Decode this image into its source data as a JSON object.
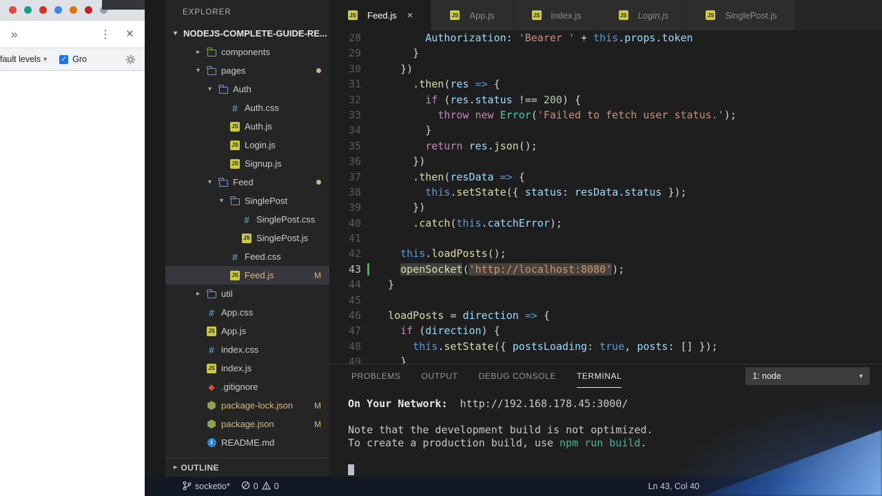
{
  "colors": {
    "git_modified": "#d7ba7d",
    "js_icon": "#cbcb41",
    "css_icon": "#519aba",
    "git_icon": "#e1503c",
    "npm_icon": "#8aa34f",
    "readme_icon": "#2f86d2",
    "modified_gutter": "#3fb950",
    "terminal_command": "#45b797",
    "glare_blue": "#3c82ff"
  },
  "browser": {
    "favicons": [
      {
        "name": "favicon-1",
        "color": "#e8453c"
      },
      {
        "name": "favicon-2",
        "color": "#1f9d8b"
      },
      {
        "name": "favicon-3",
        "color": "#d93025"
      },
      {
        "name": "favicon-4",
        "color": "#4285f4"
      },
      {
        "name": "favicon-5",
        "color": "#e37400"
      },
      {
        "name": "favicon-6",
        "color": "#c5221f"
      },
      {
        "name": "favicon-7",
        "color": "#9aa0a6"
      }
    ],
    "toolbar": {
      "overflow": "»",
      "menu": "⋮",
      "close": "×"
    },
    "console_bar": {
      "levels_label": "fault levels",
      "caret": "▾",
      "check": "✓",
      "group_label": "Gro"
    }
  },
  "sidebar": {
    "title": "EXPLORER",
    "section": {
      "chevron": "▾",
      "label": "NODEJS-COMPLETE-GUIDE-RE..."
    },
    "items": [
      {
        "label": "components",
        "icon": "folder",
        "icon_color": "#7cb342",
        "depth": 1,
        "chevron": "closed"
      },
      {
        "label": "pages",
        "icon": "folder",
        "depth": 1,
        "chevron": "open",
        "dot": true
      },
      {
        "label": "Auth",
        "icon": "folder",
        "depth": 2,
        "chevron": "open"
      },
      {
        "label": "Auth.css",
        "icon": "css",
        "depth": 3
      },
      {
        "label": "Auth.js",
        "icon": "js",
        "depth": 3
      },
      {
        "label": "Login.js",
        "icon": "js",
        "depth": 3
      },
      {
        "label": "Signup.js",
        "icon": "js",
        "depth": 3
      },
      {
        "label": "Feed",
        "icon": "folder",
        "depth": 2,
        "chevron": "open",
        "dot": true
      },
      {
        "label": "SinglePost",
        "icon": "folder",
        "depth": 3,
        "chevron": "open"
      },
      {
        "label": "SinglePost.css",
        "icon": "css",
        "depth": 4
      },
      {
        "label": "SinglePost.js",
        "icon": "js",
        "depth": 4
      },
      {
        "label": "Feed.css",
        "icon": "css",
        "depth": 3
      },
      {
        "label": "Feed.js",
        "icon": "js",
        "depth": 3,
        "selected": true,
        "badge": "M",
        "modified": true
      },
      {
        "label": "util",
        "icon": "folder",
        "depth": 1,
        "chevron": "closed"
      },
      {
        "label": "App.css",
        "icon": "css",
        "depth": 1
      },
      {
        "label": "App.js",
        "icon": "js",
        "depth": 1
      },
      {
        "label": "index.css",
        "icon": "css",
        "depth": 1
      },
      {
        "label": "index.js",
        "icon": "js",
        "depth": 1
      },
      {
        "label": ".gitignore",
        "icon": "git",
        "depth": 1
      },
      {
        "label": "package-lock.json",
        "icon": "npm",
        "depth": 1,
        "badge": "M",
        "modified": true
      },
      {
        "label": "package.json",
        "icon": "npm",
        "depth": 1,
        "badge": "M",
        "modified": true
      },
      {
        "label": "README.md",
        "icon": "info",
        "depth": 1
      }
    ],
    "outline": {
      "chevron": "▸",
      "label": "OUTLINE"
    }
  },
  "tabs": [
    {
      "label": "Feed.js",
      "icon": "js",
      "active": true,
      "close": "×"
    },
    {
      "label": "App.js",
      "icon": "js"
    },
    {
      "label": "index.js",
      "icon": "js"
    },
    {
      "label": "Login.js",
      "icon": "js",
      "italic": true
    },
    {
      "label": "SinglePost.js",
      "icon": "js"
    }
  ],
  "editor": {
    "lines": [
      {
        "num": "28",
        "tokens": [
          [
            "pl",
            "        "
          ],
          [
            "pr",
            "Authorization"
          ],
          [
            "pl",
            ": "
          ],
          [
            "st",
            "'Bearer '"
          ],
          [
            "pl",
            " + "
          ],
          [
            "kb",
            "this"
          ],
          [
            "pl",
            "."
          ],
          [
            "pr",
            "props"
          ],
          [
            "pl",
            "."
          ],
          [
            "pr",
            "token"
          ]
        ]
      },
      {
        "num": "29",
        "tokens": [
          [
            "pl",
            "      }"
          ]
        ]
      },
      {
        "num": "30",
        "tokens": [
          [
            "pl",
            "    })"
          ]
        ]
      },
      {
        "num": "31",
        "tokens": [
          [
            "pl",
            "      ."
          ],
          [
            "fn",
            "then"
          ],
          [
            "pl",
            "("
          ],
          [
            "pr",
            "res"
          ],
          [
            "pl",
            " "
          ],
          [
            "kb",
            "=>"
          ],
          [
            "pl",
            " {"
          ]
        ]
      },
      {
        "num": "32",
        "tokens": [
          [
            "pl",
            "        "
          ],
          [
            "kw",
            "if"
          ],
          [
            "pl",
            " ("
          ],
          [
            "pr",
            "res"
          ],
          [
            "pl",
            "."
          ],
          [
            "pr",
            "status"
          ],
          [
            "pl",
            " !== "
          ],
          [
            "nu",
            "200"
          ],
          [
            "pl",
            ") {"
          ]
        ]
      },
      {
        "num": "33",
        "tokens": [
          [
            "pl",
            "          "
          ],
          [
            "kw",
            "throw"
          ],
          [
            "pl",
            " "
          ],
          [
            "kw",
            "new"
          ],
          [
            "pl",
            " "
          ],
          [
            "cl2",
            "Error"
          ],
          [
            "pl",
            "("
          ],
          [
            "st",
            "'Failed to fetch user status.'"
          ],
          [
            "pl",
            ");"
          ]
        ]
      },
      {
        "num": "34",
        "tokens": [
          [
            "pl",
            "        }"
          ]
        ]
      },
      {
        "num": "35",
        "tokens": [
          [
            "pl",
            "        "
          ],
          [
            "kw",
            "return"
          ],
          [
            "pl",
            " "
          ],
          [
            "pr",
            "res"
          ],
          [
            "pl",
            "."
          ],
          [
            "fn",
            "json"
          ],
          [
            "pl",
            "();"
          ]
        ]
      },
      {
        "num": "36",
        "tokens": [
          [
            "pl",
            "      })"
          ]
        ]
      },
      {
        "num": "37",
        "tokens": [
          [
            "pl",
            "      ."
          ],
          [
            "fn",
            "then"
          ],
          [
            "pl",
            "("
          ],
          [
            "pr",
            "resData"
          ],
          [
            "pl",
            " "
          ],
          [
            "kb",
            "=>"
          ],
          [
            "pl",
            " {"
          ]
        ]
      },
      {
        "num": "38",
        "tokens": [
          [
            "pl",
            "        "
          ],
          [
            "kb",
            "this"
          ],
          [
            "pl",
            "."
          ],
          [
            "fn",
            "setState"
          ],
          [
            "pl",
            "({ "
          ],
          [
            "pr",
            "status"
          ],
          [
            "pl",
            ": "
          ],
          [
            "pr",
            "resData"
          ],
          [
            "pl",
            "."
          ],
          [
            "pr",
            "status"
          ],
          [
            "pl",
            " });"
          ]
        ]
      },
      {
        "num": "39",
        "tokens": [
          [
            "pl",
            "      })"
          ]
        ]
      },
      {
        "num": "40",
        "tokens": [
          [
            "pl",
            "      ."
          ],
          [
            "fn",
            "catch"
          ],
          [
            "pl",
            "("
          ],
          [
            "kb",
            "this"
          ],
          [
            "pl",
            "."
          ],
          [
            "pr",
            "catchError"
          ],
          [
            "pl",
            ");"
          ]
        ]
      },
      {
        "num": "41",
        "tokens": []
      },
      {
        "num": "42",
        "tokens": [
          [
            "pl",
            "    "
          ],
          [
            "kb",
            "this"
          ],
          [
            "pl",
            "."
          ],
          [
            "fn",
            "loadPosts"
          ],
          [
            "pl",
            "();"
          ]
        ]
      },
      {
        "num": "43",
        "current": true,
        "modified": true,
        "tokens": [
          [
            "pl",
            "    "
          ],
          [
            "fn hlw",
            "openSocket"
          ],
          [
            "pl",
            "("
          ],
          [
            "st hls",
            "'http://localhost:8080'"
          ],
          [
            "pl",
            ");"
          ]
        ]
      },
      {
        "num": "44",
        "tokens": [
          [
            "pl",
            "  }"
          ]
        ]
      },
      {
        "num": "45",
        "tokens": []
      },
      {
        "num": "46",
        "tokens": [
          [
            "pl",
            "  "
          ],
          [
            "fn",
            "loadPosts"
          ],
          [
            "pl",
            " = "
          ],
          [
            "pr",
            "direction"
          ],
          [
            "pl",
            " "
          ],
          [
            "kb",
            "=>"
          ],
          [
            "pl",
            " {"
          ]
        ]
      },
      {
        "num": "47",
        "tokens": [
          [
            "pl",
            "    "
          ],
          [
            "kw",
            "if"
          ],
          [
            "pl",
            " ("
          ],
          [
            "pr",
            "direction"
          ],
          [
            "pl",
            ") {"
          ]
        ]
      },
      {
        "num": "48",
        "tokens": [
          [
            "pl",
            "      "
          ],
          [
            "kb",
            "this"
          ],
          [
            "pl",
            "."
          ],
          [
            "fn",
            "setState"
          ],
          [
            "pl",
            "({ "
          ],
          [
            "pr",
            "postsLoading"
          ],
          [
            "pl",
            ": "
          ],
          [
            "kb",
            "true"
          ],
          [
            "pl",
            ", "
          ],
          [
            "pr",
            "posts"
          ],
          [
            "pl",
            ": [] });"
          ]
        ]
      },
      {
        "num": "49",
        "tokens": [
          [
            "pl",
            "    }"
          ]
        ]
      }
    ]
  },
  "panel": {
    "tabs": [
      {
        "label": "PROBLEMS"
      },
      {
        "label": "OUTPUT"
      },
      {
        "label": "DEBUG CONSOLE"
      },
      {
        "label": "TERMINAL",
        "active": true
      }
    ],
    "selector": {
      "value": "1: node",
      "caret": "▾"
    },
    "terminal": {
      "lines": [
        [
          [
            "b",
            "On Your Network:"
          ],
          [
            "pl",
            "  http://192.168.178.45:3000/"
          ]
        ],
        [],
        [
          [
            "pl",
            "Note that the development build is not optimized."
          ]
        ],
        [
          [
            "pl",
            "To create a production build, use "
          ],
          [
            "cmd",
            "npm run build"
          ],
          [
            "pl",
            "."
          ]
        ],
        [],
        [
          [
            "cursor",
            ""
          ]
        ]
      ]
    }
  },
  "statusbar": {
    "branch": "socketio*",
    "errors": "0",
    "warnings": "0",
    "position": "Ln 43, Col 40"
  }
}
